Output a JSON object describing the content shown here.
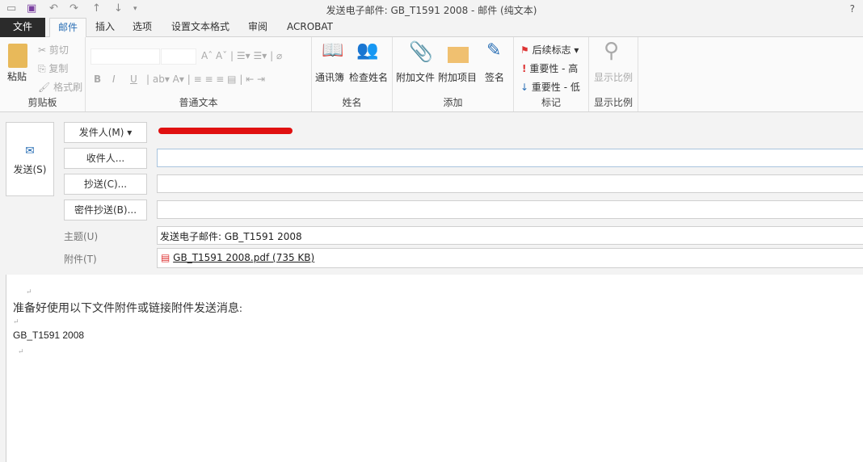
{
  "window": {
    "title": "发送电子邮件: GB_T1591 2008 - 邮件 (纯文本)",
    "help": "?"
  },
  "tabs": [
    "文件",
    "邮件",
    "插入",
    "选项",
    "设置文本格式",
    "审阅",
    "ACROBAT"
  ],
  "ribbon": {
    "clipboard": {
      "paste": "粘贴",
      "cut": "剪切",
      "copy": "复制",
      "format_painter": "格式刷",
      "label": "剪贴板"
    },
    "basic_text": {
      "label": "普通文本",
      "bold": "B",
      "italic": "I",
      "underline": "U"
    },
    "names": {
      "address_book": "通讯簿",
      "check_names": "检查姓名",
      "label": "姓名"
    },
    "include": {
      "attach_file": "附加文件",
      "attach_item": "附加项目",
      "signature": "签名",
      "label": "添加"
    },
    "tags": {
      "follow_up": "后续标志",
      "high": "重要性 - 高",
      "low": "重要性 - 低",
      "label": "标记"
    },
    "zoom": {
      "zoom": "显示比例",
      "label": "显示比例"
    }
  },
  "compose": {
    "send": "发送(S)",
    "from": "发件人(M)",
    "to": "收件人...",
    "cc": "抄送(C)...",
    "bcc": "密件抄送(B)...",
    "subject_label": "主题(U)",
    "subject": "发送电子邮件: GB_T1591 2008",
    "attached_label": "附件(T)",
    "attachment": "GB_T1591 2008.pdf (735 KB)"
  },
  "body": {
    "line1": "准备好使用以下文件附件或链接附件发送消息:",
    "line2": "GB_T1591 2008"
  }
}
